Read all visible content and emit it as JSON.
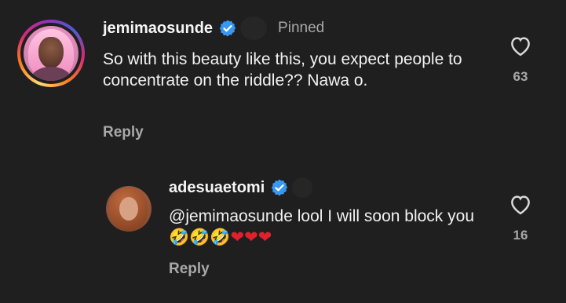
{
  "comments": [
    {
      "username": "jemimaosunde",
      "pinned_label": "Pinned",
      "text": "So with this beauty like this, you expect people to concentrate on the riddle?? Nawa o.",
      "reply_label": "Reply",
      "like_count": "63"
    },
    {
      "username": "adesuaetomi",
      "text_plain": "@jemimaosunde lool I will soon block you",
      "emojis": [
        "🤣",
        "🤣",
        "🤣",
        "❤",
        "❤",
        "❤"
      ],
      "reply_label": "Reply",
      "like_count": "16"
    }
  ],
  "colors": {
    "background": "#1f1f1f",
    "verified": "#3897f0",
    "muted_text": "#a8a8a8"
  },
  "icons": {
    "verified": "verified-badge-icon",
    "like": "heart-outline-icon"
  }
}
